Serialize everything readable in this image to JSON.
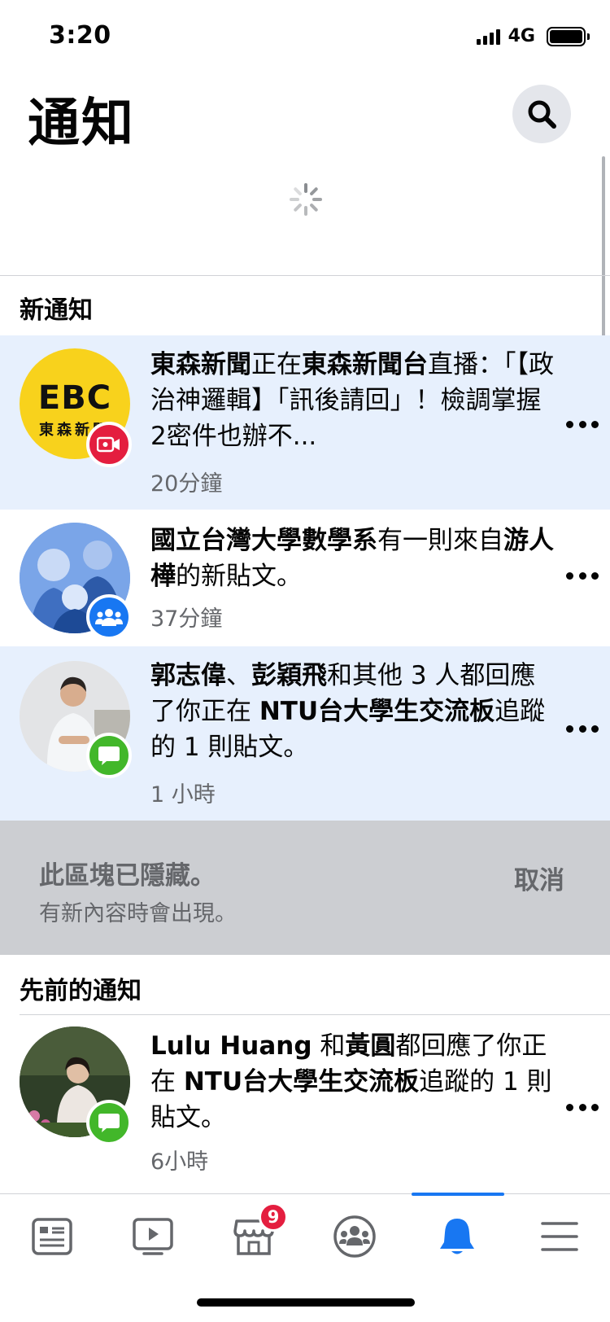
{
  "status_bar": {
    "time": "3:20",
    "network": "4G"
  },
  "header": {
    "title": "通知"
  },
  "sections": {
    "new_header": "新通知",
    "earlier_header": "先前的通知"
  },
  "notifications": [
    {
      "avatar_text_top": "EBC",
      "avatar_text_bottom": "東森新聞",
      "parts": [
        {
          "bold": "東森新聞"
        },
        {
          "text": "正在"
        },
        {
          "bold": "東森新聞台"
        },
        {
          "text": "直播：「【政治神邏輯】「訊後請回」！檢調掌握2密件也辦不..."
        }
      ],
      "time": "20分鐘",
      "badge": "video-live-icon",
      "unread": true
    },
    {
      "parts": [
        {
          "bold": "國立台灣大學數學系"
        },
        {
          "text": "有一則來自"
        },
        {
          "bold": "游人樺"
        },
        {
          "text": "的新貼文。"
        }
      ],
      "time": "37分鐘",
      "badge": "group-icon",
      "unread": false
    },
    {
      "parts": [
        {
          "bold": "郭志偉"
        },
        {
          "text": "、"
        },
        {
          "bold": "彭穎飛"
        },
        {
          "text": "和其他 3 人都回應了你正在 "
        },
        {
          "bold": "NTU台大學生交流板"
        },
        {
          "text": "追蹤的 1 則貼文。"
        }
      ],
      "time": "1 小時",
      "badge": "comment-icon",
      "unread": true
    },
    {
      "parts": [
        {
          "bold": "Lulu Huang"
        },
        {
          "text": " 和"
        },
        {
          "bold": "黃圓"
        },
        {
          "text": "都回應了你正在 "
        },
        {
          "bold": "NTU台大學生交流板"
        },
        {
          "text": "追蹤的 1 則貼文。"
        }
      ],
      "time": "6小時",
      "badge": "comment-icon",
      "unread": false
    }
  ],
  "hidden_section": {
    "title": "此區塊已隱藏。",
    "subtitle": "有新內容時會出現。",
    "cancel_label": "取消"
  },
  "tabbar": {
    "items": [
      "news-feed-icon",
      "watch-icon",
      "marketplace-icon",
      "groups-icon",
      "notifications-icon",
      "menu-icon"
    ],
    "active": "notifications-icon",
    "marketplace_badge": "9"
  },
  "colors": {
    "accent": "#1877f2",
    "unread_bg": "#e7f0fd",
    "hidden_bg": "#ccced2",
    "badge_red": "#e41e3f",
    "badge_green": "#42b72a",
    "avatar_ebc_yellow": "#f8d21c"
  }
}
